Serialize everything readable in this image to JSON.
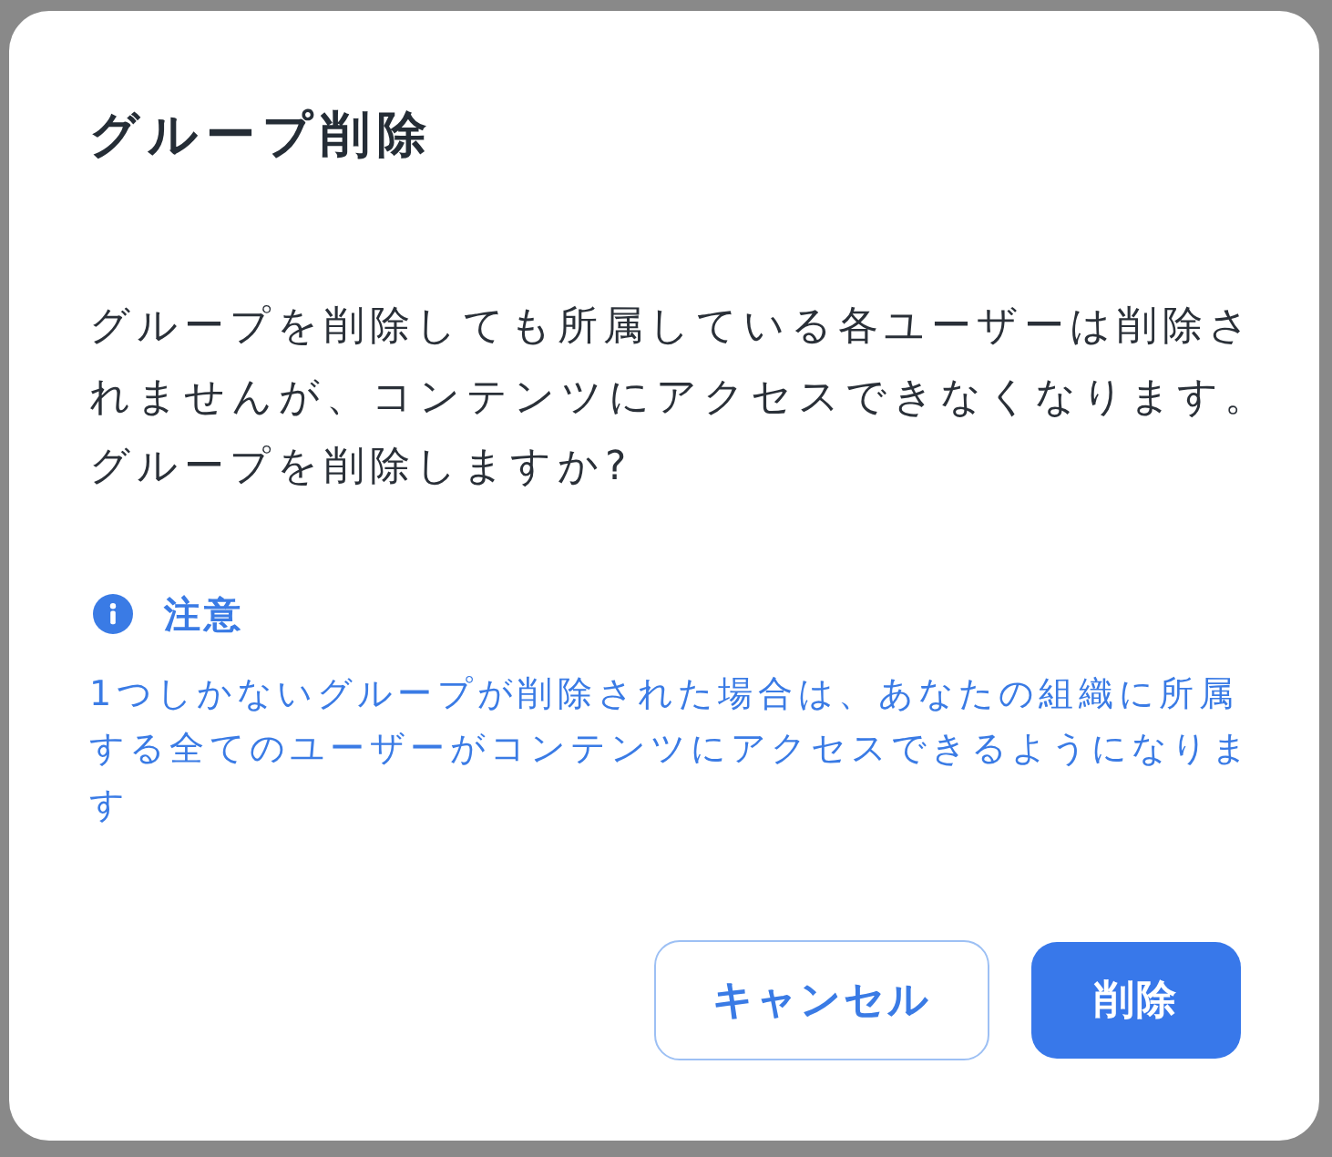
{
  "dialog": {
    "title": "グループ削除",
    "message": "グループを削除しても所属している各ユーザーは削除されませんが、コンテンツにアクセスできなくなります。グループを削除しますか?",
    "notice": {
      "kind": "info",
      "heading": "注意",
      "text": "1つしかないグループが削除された場合は、あなたの組織に所属する全てのユーザーがコンテンツにアクセスできるようになります"
    },
    "buttons": [
      {
        "label": "キャンセル",
        "kind": "secondary"
      },
      {
        "label": "削除",
        "kind": "primary"
      }
    ]
  }
}
